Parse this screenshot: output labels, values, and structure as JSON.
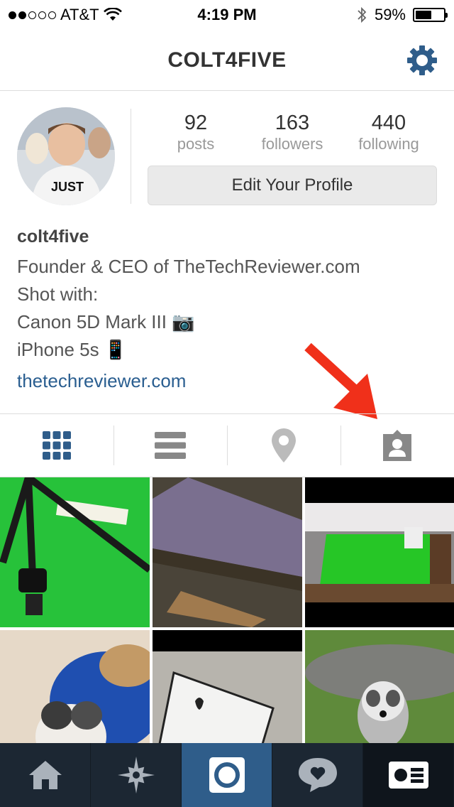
{
  "status_bar": {
    "carrier": "AT&T",
    "time": "4:19 PM",
    "battery": "59%",
    "battery_level": 0.59,
    "signal_bars_filled": 2,
    "signal_bars_total": 5
  },
  "header": {
    "title": "COLT4FIVE",
    "settings_icon": "gear-icon"
  },
  "profile": {
    "stats": [
      {
        "value": "92",
        "label": "posts"
      },
      {
        "value": "163",
        "label": "followers"
      },
      {
        "value": "440",
        "label": "following"
      }
    ],
    "edit_button": "Edit Your Profile",
    "username": "colt4five",
    "bio_lines": [
      "Founder & CEO of TheTechReviewer.com",
      "Shot with:",
      "Canon 5D Mark III 📷",
      "iPhone 5s 📱"
    ],
    "website": "thetechreviewer.com"
  },
  "view_tabs": [
    {
      "icon": "grid-icon",
      "active": true
    },
    {
      "icon": "list-icon",
      "active": false
    },
    {
      "icon": "location-pin-icon",
      "active": false
    },
    {
      "icon": "tagged-photos-icon",
      "active": false
    }
  ],
  "bottom_tabs": [
    {
      "icon": "home-icon",
      "active": false
    },
    {
      "icon": "explore-icon",
      "active": false
    },
    {
      "icon": "camera-icon",
      "active": true
    },
    {
      "icon": "activity-heart-icon",
      "active": false
    },
    {
      "icon": "profile-card-icon",
      "active": false
    }
  ],
  "colors": {
    "accent": "#2f5d8a",
    "link": "#2a5e90",
    "annotation_arrow": "#f0301a",
    "tabbar": "#1c2733"
  }
}
